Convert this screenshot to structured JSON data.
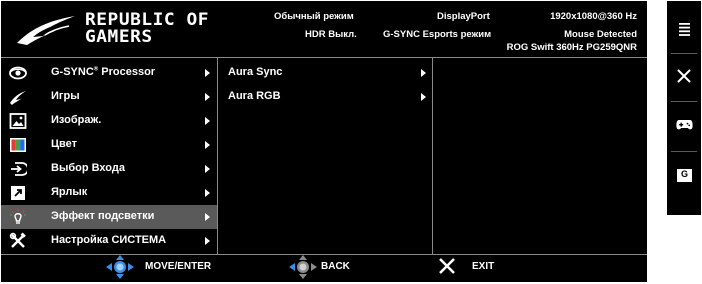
{
  "header": {
    "logo_line1": "REPUBLIC OF",
    "logo_line2": "GAMERS",
    "mode": "Обычный режим",
    "hdr": "HDR Выкл.",
    "input": "DisplayPort",
    "gsync": "G-SYNC Esports режим",
    "resolution": "1920x1080@360 Hz",
    "mouse": "Mouse Detected",
    "model": "ROG Swift 360Hz PG259QNR"
  },
  "menu": {
    "items": [
      {
        "label": "G-SYNC",
        "sup": "®",
        "label_suffix": " Processor",
        "icon": "nvidia-eye-icon"
      },
      {
        "label": "Игры",
        "icon": "rog-eye-icon"
      },
      {
        "label": "Изображ.",
        "icon": "image-icon"
      },
      {
        "label": "Цвет",
        "icon": "color-icon"
      },
      {
        "label": "Выбор Входа",
        "icon": "input-select-icon"
      },
      {
        "label": "Ярлык",
        "icon": "shortcut-icon"
      },
      {
        "label": "Эффект подсветки",
        "icon": "light-effect-icon",
        "selected": true
      },
      {
        "label": "Настройка СИСТЕМА",
        "icon": "system-tools-icon"
      }
    ]
  },
  "submenu": {
    "items": [
      {
        "label": "Aura Sync"
      },
      {
        "label": "Aura RGB"
      }
    ]
  },
  "footer": {
    "move_enter": "MOVE/ENTER",
    "back": "BACK",
    "exit": "EXIT"
  },
  "sidebar": {
    "glyph_g": "G"
  },
  "colors": {
    "background": "#000000",
    "selected_row": "#5a5a5a",
    "divider": "#8a8a8a",
    "joystick_blue": "#3a8ee6"
  }
}
